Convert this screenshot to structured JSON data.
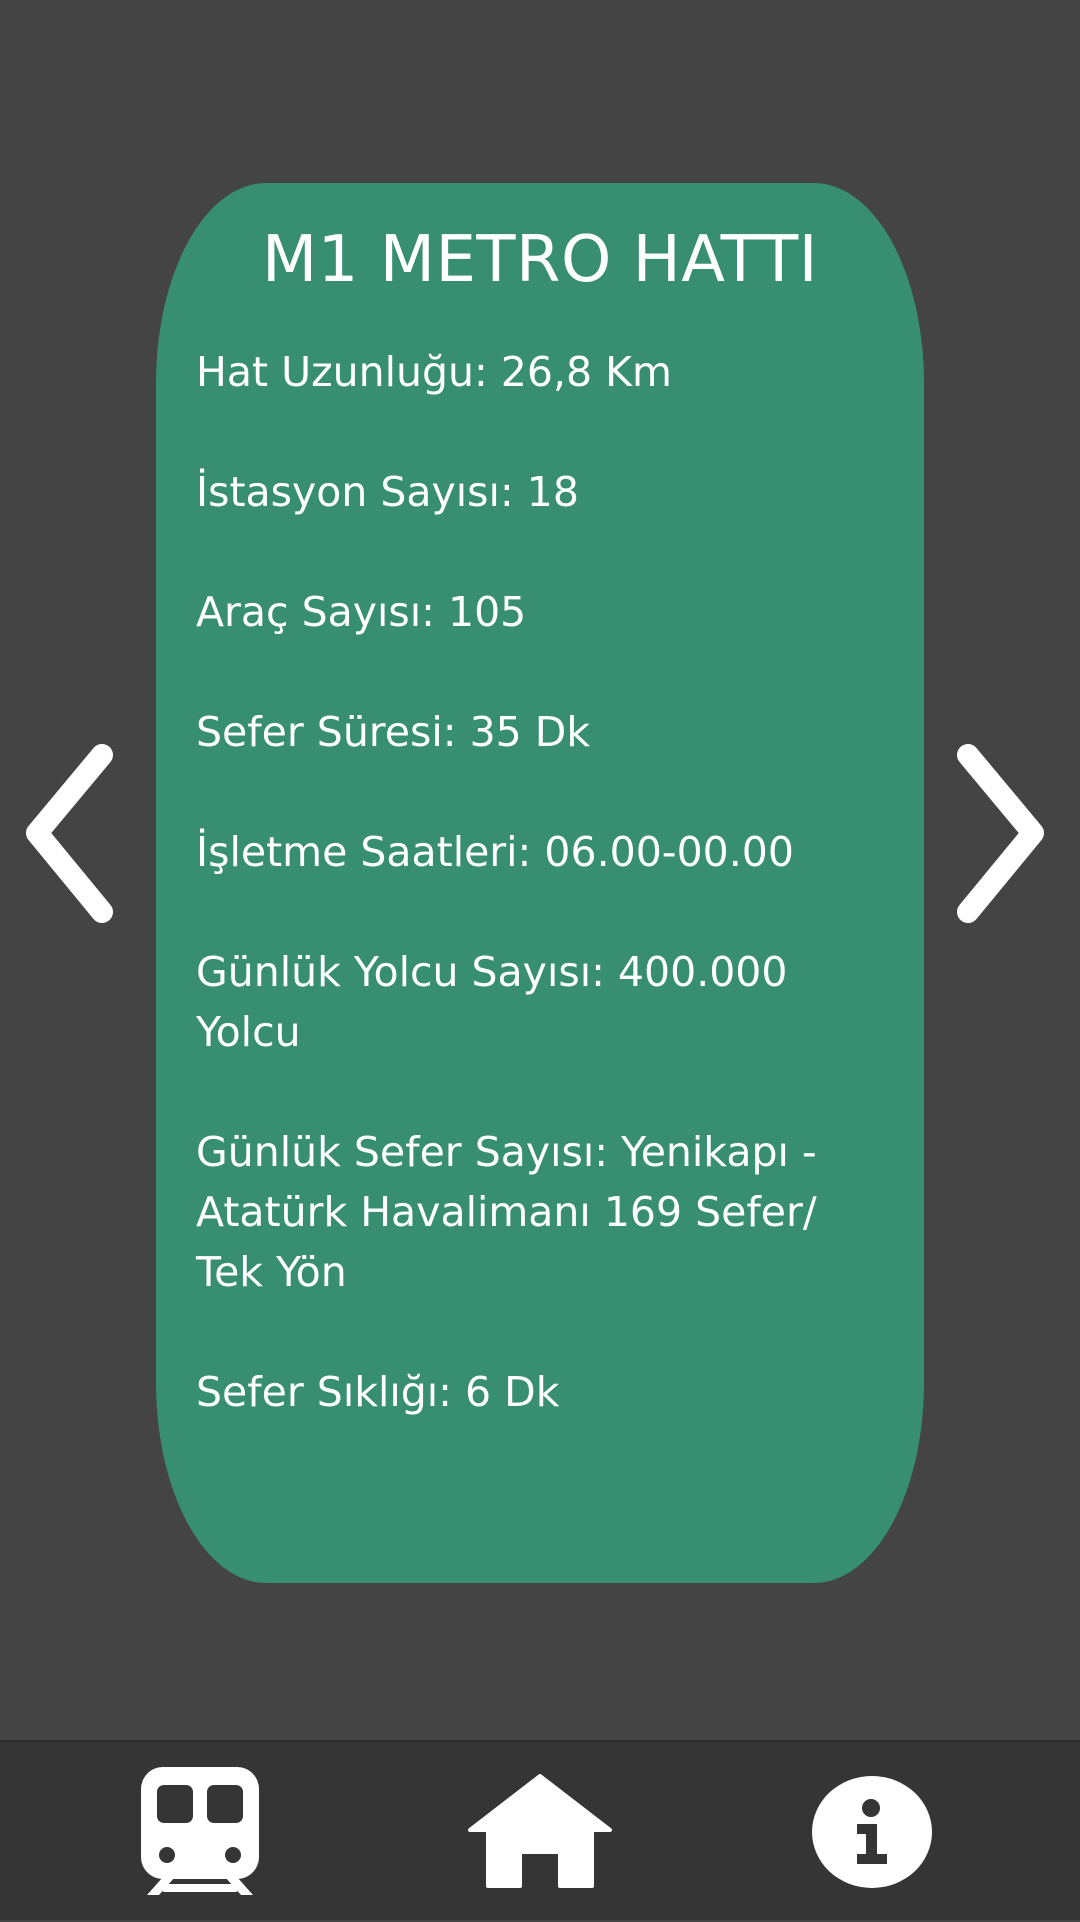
{
  "card": {
    "title": "M1 METRO HATTI",
    "items": [
      "Hat Uzunluğu: 26,8 Km",
      "İstasyon Sayısı: 18",
      "Araç Sayısı: 105",
      "Sefer Süresi: 35 Dk",
      "İşletme Saatleri: 06.00-00.00",
      "Günlük Yolcu Sayısı: 400.000 Yolcu",
      "Günlük Sefer Sayısı: Yenikapı - Atatürk Havalimanı 169 Sefer/ Tek Yön",
      "Sefer Sıklığı: 6 Dk"
    ]
  },
  "navigation": {
    "previous_icon": "chevron-left-icon",
    "next_icon": "chevron-right-icon"
  },
  "bottom_bar": {
    "items": [
      {
        "icon": "train-icon"
      },
      {
        "icon": "home-icon"
      },
      {
        "icon": "info-icon"
      }
    ]
  },
  "colors": {
    "background": "#444444",
    "card": "#378e71",
    "bottom_bar": "#353535",
    "foreground": "#ffffff"
  }
}
